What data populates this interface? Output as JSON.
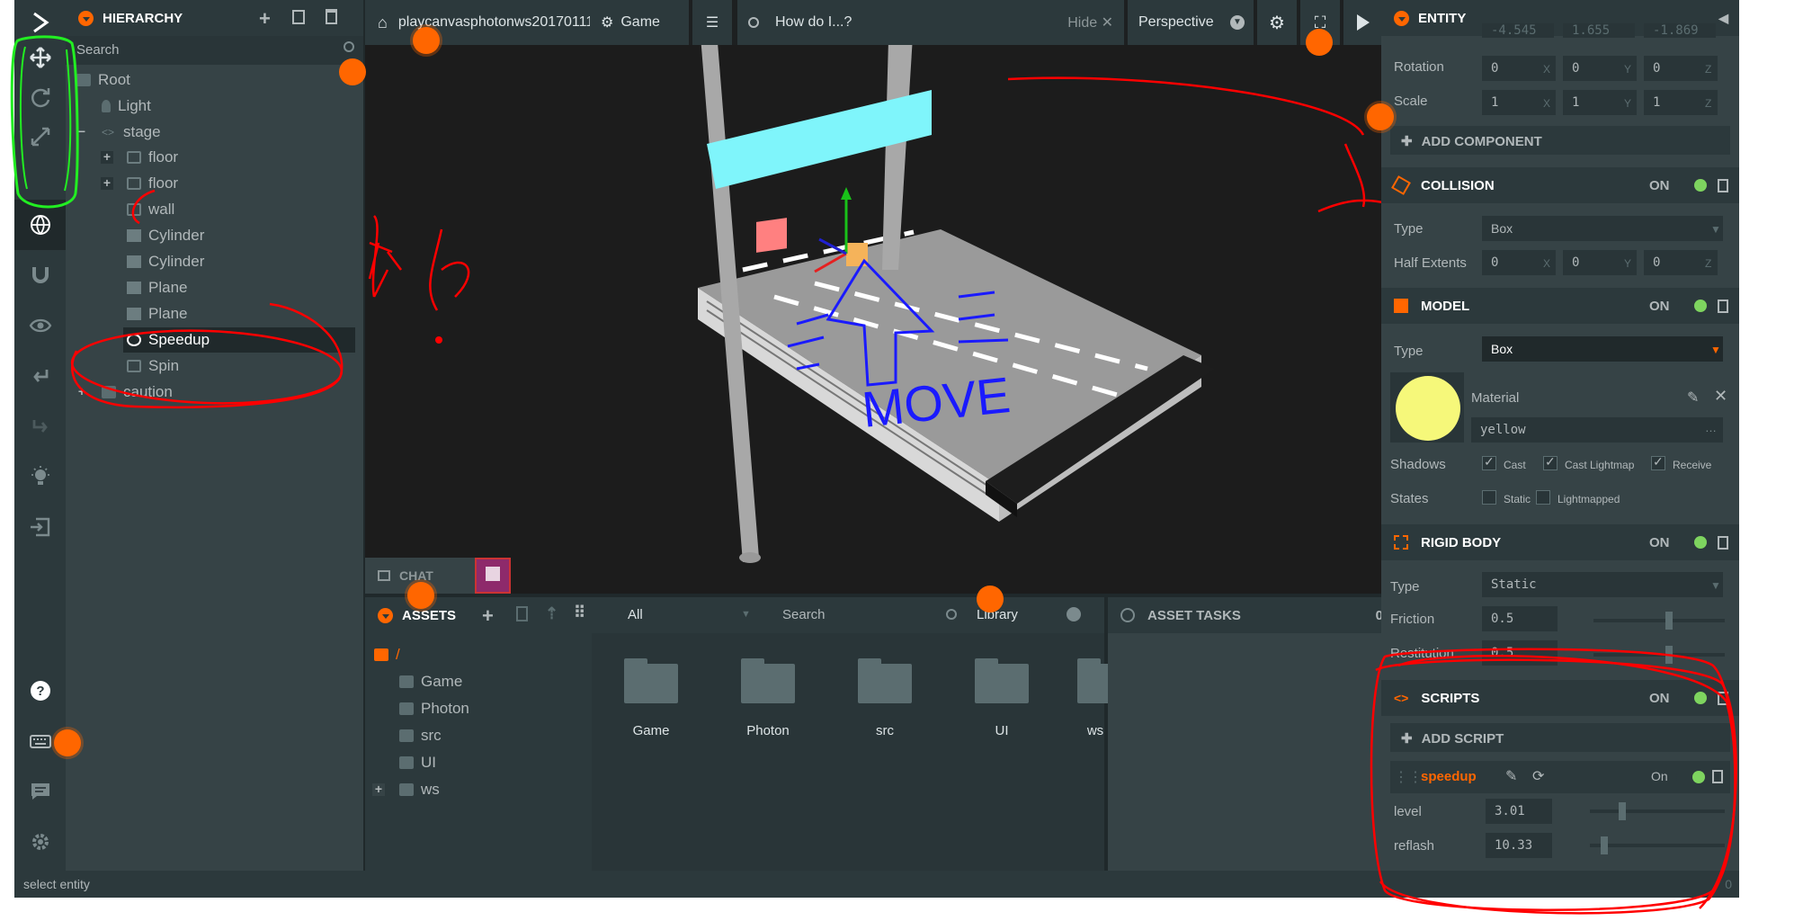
{
  "hierarchy": {
    "title": "HIERARCHY",
    "search_placeholder": "Search",
    "items": [
      "Root",
      "Light",
      "stage",
      "floor",
      "floor",
      "wall",
      "Cylinder",
      "Cylinder",
      "Plane",
      "Plane",
      "Speedup",
      "Spin",
      "caution"
    ]
  },
  "viewport": {
    "project": "playcanvasphotonws20170111",
    "scene": "Game",
    "help_placeholder": "How do I...?",
    "hide_label": "Hide",
    "camera": "Perspective",
    "move_annotation": "MOVE"
  },
  "chat": {
    "label": "CHAT"
  },
  "assets": {
    "title": "ASSETS",
    "filter": "All",
    "search_placeholder": "Search",
    "library": "Library",
    "path": "/",
    "tree": [
      "Game",
      "Photon",
      "src",
      "UI",
      "ws"
    ],
    "folders": [
      "Game",
      "Photon",
      "src",
      "UI",
      "ws"
    ]
  },
  "asset_tasks": {
    "title": "ASSET TASKS",
    "count": "0"
  },
  "inspector": {
    "title": "ENTITY",
    "position_values": [
      "-4.545",
      "1.655",
      "-1.869"
    ],
    "rotation_label": "Rotation",
    "rotation_values": [
      "0",
      "0",
      "0"
    ],
    "scale_label": "Scale",
    "scale_values": [
      "1",
      "1",
      "1"
    ],
    "axes": [
      "X",
      "Y",
      "Z"
    ],
    "add_component": "ADD COMPONENT",
    "collision": {
      "title": "COLLISION",
      "on": "ON",
      "type_label": "Type",
      "type": "Box",
      "half_label": "Half Extents",
      "half": [
        "0",
        "0",
        "0"
      ]
    },
    "model": {
      "title": "MODEL",
      "on": "ON",
      "type_label": "Type",
      "type": "Box",
      "material_label": "Material",
      "material": "yellow",
      "material_color": "#f6f87a",
      "shadows_label": "Shadows",
      "cast": "Cast",
      "cast_lightmap": "Cast Lightmap",
      "receive": "Receive",
      "states_label": "States",
      "static": "Static",
      "lightmapped": "Lightmapped"
    },
    "rigidbody": {
      "title": "RIGID BODY",
      "on": "ON",
      "type_label": "Type",
      "type": "Static",
      "friction_label": "Friction",
      "friction": "0.5",
      "restitution_label": "Restitution",
      "restitution": "0.5"
    },
    "scripts": {
      "title": "SCRIPTS",
      "on": "ON",
      "add_script": "ADD SCRIPT",
      "script_name": "speedup",
      "script_on": "On",
      "level_label": "level",
      "level": "3.01",
      "reflash_label": "reflash",
      "reflash": "10.33"
    }
  },
  "status": {
    "text": "select entity",
    "count": "0"
  },
  "colors": {
    "accent": "#ff6600",
    "annotation_red": "#ff0000",
    "annotation_green": "#22ee22",
    "annotation_blue": "#1a1aff"
  }
}
